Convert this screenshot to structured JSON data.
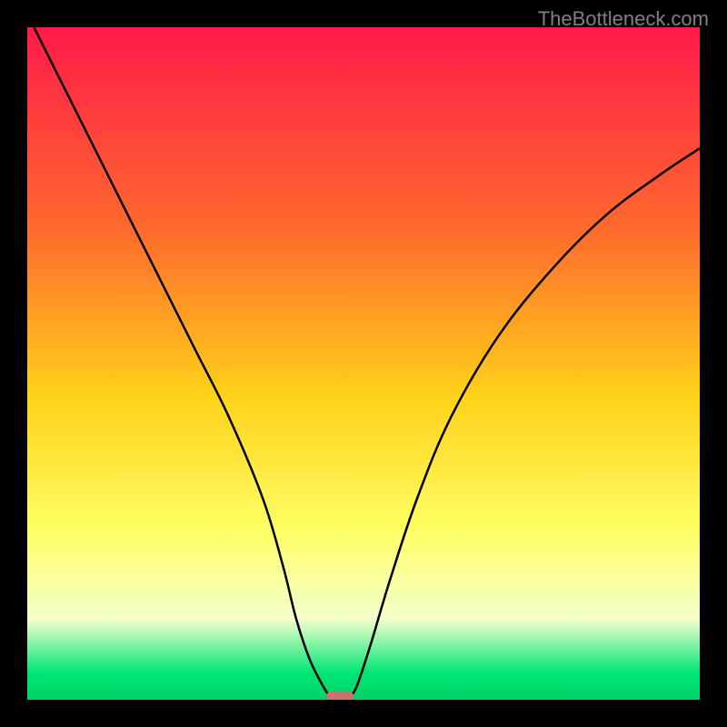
{
  "watermark": "TheBottleneck.com",
  "chart_data": {
    "type": "line",
    "title": "",
    "xlabel": "",
    "ylabel": "",
    "xlim": [
      0,
      100
    ],
    "ylim": [
      0,
      100
    ],
    "background_gradient": {
      "type": "vertical",
      "stops": [
        {
          "pos": 0,
          "color": "#ff1a4a"
        },
        {
          "pos": 30,
          "color": "#ff6a2d"
        },
        {
          "pos": 55,
          "color": "#ffd21a"
        },
        {
          "pos": 75,
          "color": "#ffff66"
        },
        {
          "pos": 88,
          "color": "#f4ffcc"
        },
        {
          "pos": 96,
          "color": "#00e676"
        },
        {
          "pos": 100,
          "color": "#00d268"
        }
      ]
    },
    "series": [
      {
        "name": "left-curve",
        "color": "#000000",
        "stroke_width": 2,
        "points": [
          {
            "x": 1,
            "y": 100
          },
          {
            "x": 5,
            "y": 92
          },
          {
            "x": 10,
            "y": 82
          },
          {
            "x": 15,
            "y": 72
          },
          {
            "x": 20,
            "y": 62
          },
          {
            "x": 25,
            "y": 52
          },
          {
            "x": 30,
            "y": 42
          },
          {
            "x": 35,
            "y": 30
          },
          {
            "x": 38,
            "y": 20
          },
          {
            "x": 40,
            "y": 12
          },
          {
            "x": 42,
            "y": 6
          },
          {
            "x": 44,
            "y": 2
          },
          {
            "x": 45,
            "y": 0.5
          }
        ]
      },
      {
        "name": "right-curve",
        "color": "#000000",
        "stroke_width": 2,
        "points": [
          {
            "x": 48,
            "y": 0.5
          },
          {
            "x": 49,
            "y": 2
          },
          {
            "x": 51,
            "y": 8
          },
          {
            "x": 54,
            "y": 18
          },
          {
            "x": 58,
            "y": 30
          },
          {
            "x": 63,
            "y": 42
          },
          {
            "x": 70,
            "y": 54
          },
          {
            "x": 78,
            "y": 64
          },
          {
            "x": 86,
            "y": 72
          },
          {
            "x": 94,
            "y": 78
          },
          {
            "x": 100,
            "y": 82
          }
        ]
      }
    ],
    "marker": {
      "name": "bottleneck-marker",
      "x": 46.5,
      "y": 0.5,
      "width": 4,
      "height": 1.5,
      "color": "#d86b6b",
      "shape": "rounded-rect"
    }
  }
}
